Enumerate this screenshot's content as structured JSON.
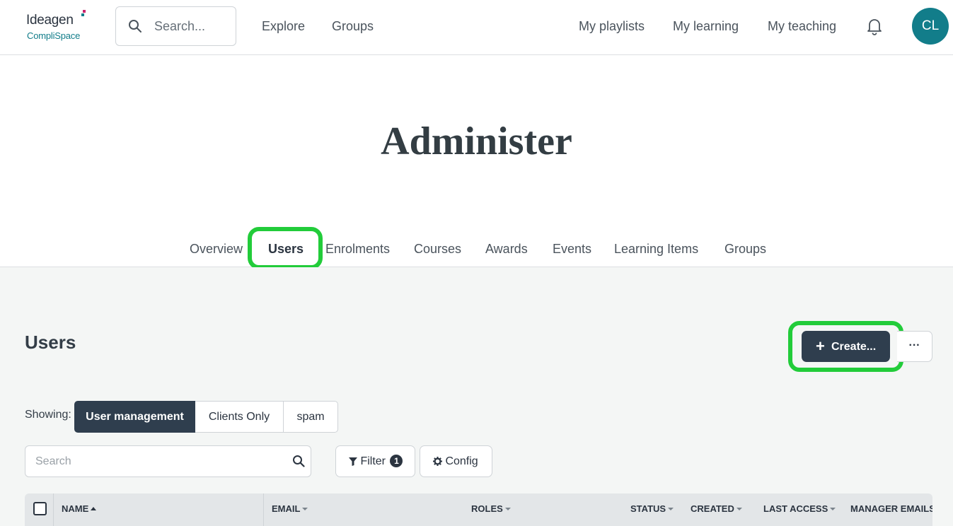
{
  "brand": {
    "name_top": "Ideagen",
    "name_bottom": "CompliSpace",
    "accent": "#127d8a"
  },
  "topnav": {
    "search_placeholder": "Search...",
    "links": [
      "Explore",
      "Groups"
    ],
    "right_links": [
      "My playlists",
      "My learning",
      "My teaching"
    ],
    "notifications_icon": "bell-icon",
    "avatar_initials": "CL"
  },
  "page": {
    "title": "Administer"
  },
  "tabs": {
    "items": [
      "Overview",
      "Users",
      "Enrolments",
      "Courses",
      "Awards",
      "Events",
      "Learning Items",
      "Groups"
    ],
    "active": "Users"
  },
  "users": {
    "title": "Users",
    "create_label": "Create...",
    "more_label": "···",
    "showing_label": "Showing:",
    "views": [
      "User management",
      "Clients Only",
      "spam"
    ],
    "active_view": "User management",
    "search_placeholder": "Search",
    "filter_label": "Filter",
    "filter_count": "1",
    "config_label": "Config",
    "columns": [
      "NAME",
      "EMAIL",
      "ROLES",
      "STATUS",
      "CREATED",
      "LAST ACCESS",
      "MANAGER EMAILS"
    ]
  },
  "colors": {
    "highlight": "#22cc3a",
    "primary_button": "#2f3e4e"
  }
}
